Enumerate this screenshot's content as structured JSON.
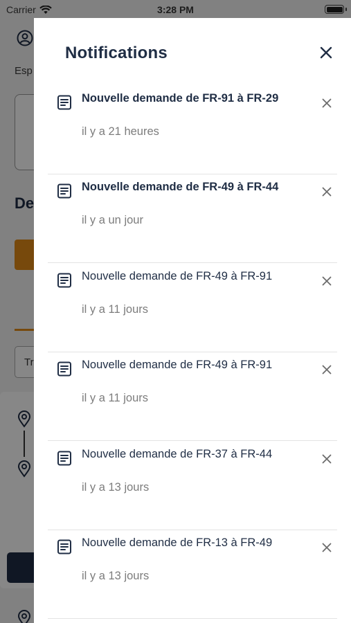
{
  "status_bar": {
    "carrier": "Carrier",
    "time": "3:28 PM"
  },
  "background": {
    "section_label": "Esp",
    "heading": "De",
    "filter_text": "Tr"
  },
  "drawer": {
    "title": "Notifications",
    "close_icon": "close-icon"
  },
  "notifications": [
    {
      "title": "Nouvelle demande de FR-91 à FR-29",
      "time": "il y a 21 heures",
      "unread": true
    },
    {
      "title": "Nouvelle demande de FR-49 à FR-44",
      "time": "il y a un jour",
      "unread": true
    },
    {
      "title": "Nouvelle demande de FR-49 à FR-91",
      "time": "il y a 11 jours",
      "unread": false
    },
    {
      "title": "Nouvelle demande de FR-49 à FR-91",
      "time": "il y a 11 jours",
      "unread": false
    },
    {
      "title": "Nouvelle demande de FR-37 à FR-44",
      "time": "il y a 13 jours",
      "unread": false
    },
    {
      "title": "Nouvelle demande de FR-13 à FR-49",
      "time": "il y a 13 jours",
      "unread": false
    }
  ],
  "colors": {
    "primary": "#1f2d44",
    "accent": "#e08a17",
    "muted_text": "#7c7c7c",
    "divider": "#e3e3e3"
  }
}
